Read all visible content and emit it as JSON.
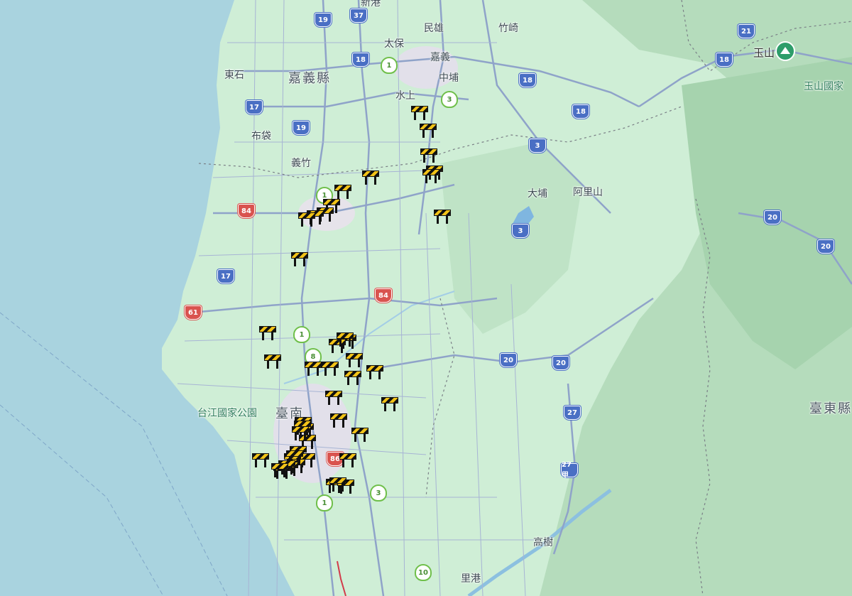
{
  "map": {
    "labels": [
      {
        "text": "新港",
        "kind": "town"
      },
      {
        "text": "民雄",
        "kind": "town"
      },
      {
        "text": "竹崎",
        "kind": "town"
      },
      {
        "text": "太保",
        "kind": "town"
      },
      {
        "text": "嘉義",
        "kind": "town"
      },
      {
        "text": "中埔",
        "kind": "town"
      },
      {
        "text": "東石",
        "kind": "town"
      },
      {
        "text": "嘉義縣",
        "kind": "county"
      },
      {
        "text": "水上",
        "kind": "town"
      },
      {
        "text": "布袋",
        "kind": "town"
      },
      {
        "text": "義竹",
        "kind": "town"
      },
      {
        "text": "大埔",
        "kind": "town"
      },
      {
        "text": "阿里山",
        "kind": "town"
      },
      {
        "text": "玉山",
        "kind": "peak"
      },
      {
        "text": "玉山國家",
        "kind": "park"
      },
      {
        "text": "台江國家公園",
        "kind": "park"
      },
      {
        "text": "臺南",
        "kind": "county"
      },
      {
        "text": "臺東縣",
        "kind": "county"
      },
      {
        "text": "高樹",
        "kind": "town"
      },
      {
        "text": "里港",
        "kind": "town"
      }
    ],
    "shields": [
      {
        "text": "19",
        "kind": "prov"
      },
      {
        "text": "37",
        "kind": "prov"
      },
      {
        "text": "18",
        "kind": "prov"
      },
      {
        "text": "1",
        "kind": "nat"
      },
      {
        "text": "3",
        "kind": "nat"
      },
      {
        "text": "18",
        "kind": "prov"
      },
      {
        "text": "18",
        "kind": "prov"
      },
      {
        "text": "17",
        "kind": "prov"
      },
      {
        "text": "19",
        "kind": "prov"
      },
      {
        "text": "3",
        "kind": "prov"
      },
      {
        "text": "1",
        "kind": "nat"
      },
      {
        "text": "84",
        "kind": "exp"
      },
      {
        "text": "3",
        "kind": "prov"
      },
      {
        "text": "17",
        "kind": "prov"
      },
      {
        "text": "84",
        "kind": "exp"
      },
      {
        "text": "61",
        "kind": "exp"
      },
      {
        "text": "1",
        "kind": "nat"
      },
      {
        "text": "8",
        "kind": "nat"
      },
      {
        "text": "20",
        "kind": "prov"
      },
      {
        "text": "20",
        "kind": "prov"
      },
      {
        "text": "27",
        "kind": "prov"
      },
      {
        "text": "86",
        "kind": "exp"
      },
      {
        "text": "27甲",
        "kind": "prov"
      },
      {
        "text": "3",
        "kind": "nat"
      },
      {
        "text": "1",
        "kind": "nat"
      },
      {
        "text": "10",
        "kind": "nat"
      },
      {
        "text": "21",
        "kind": "prov"
      },
      {
        "text": "18",
        "kind": "prov"
      },
      {
        "text": "20",
        "kind": "prov"
      },
      {
        "text": "20",
        "kind": "prov"
      }
    ],
    "barrier_count": 46,
    "colors": {
      "sea": "#a9d3df",
      "land": "#cfeed6",
      "mountain": "#b8dcc0",
      "road": "#8fa3c9",
      "expressway": "#9aa9d8"
    }
  }
}
